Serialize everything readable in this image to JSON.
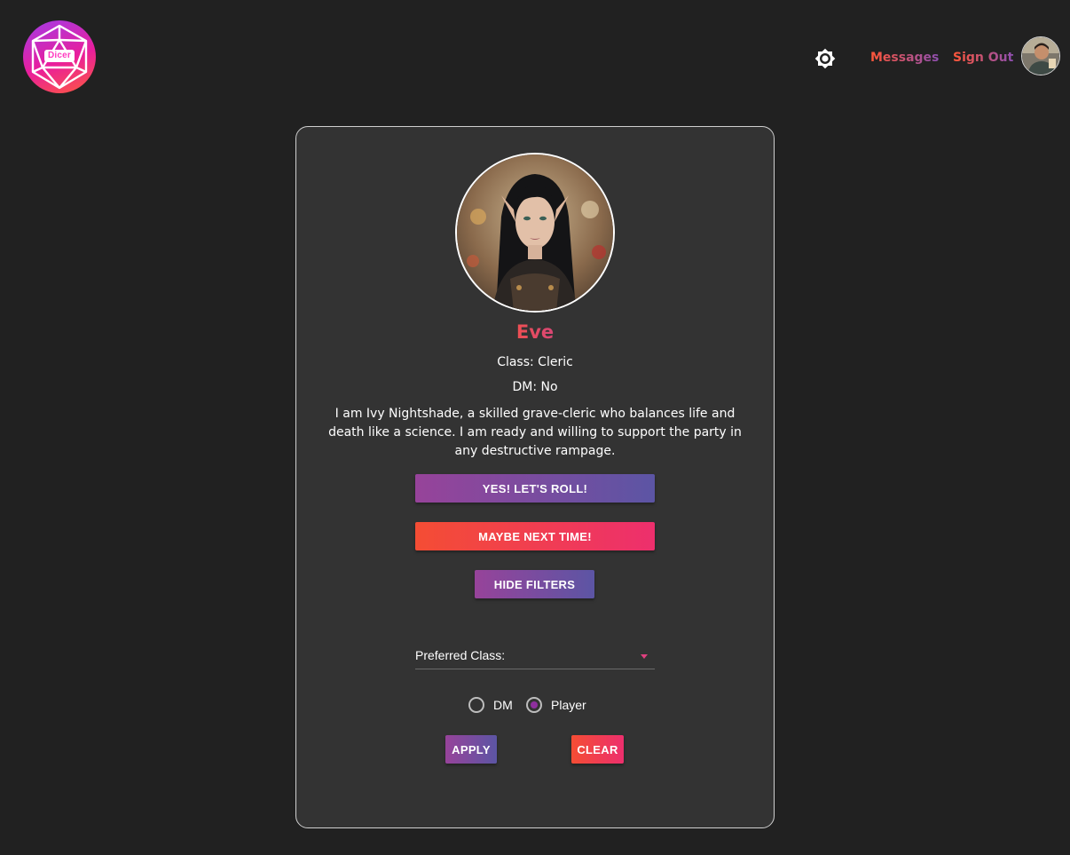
{
  "header": {
    "logo_text": "Dicer",
    "nav": {
      "messages_label": "Messages",
      "signout_label": "Sign Out"
    },
    "icons": {
      "theme": "brightness-icon",
      "user": "user-avatar"
    }
  },
  "profile": {
    "name": "Eve",
    "class_line": "Class: Cleric",
    "dm_line": "DM: No",
    "bio": "I am Ivy Nightshade, a skilled grave-cleric who balances life and death like a science. I am ready and willing to support the party in any destructive rampage."
  },
  "actions": {
    "yes_label": "YES! LET'S ROLL!",
    "maybe_label": "MAYBE NEXT TIME!",
    "hide_filters_label": "HIDE FILTERS"
  },
  "filters": {
    "preferred_class_label": "Preferred Class:",
    "radio_dm_label": "DM",
    "radio_player_label": "Player",
    "selected_role": "Player",
    "apply_label": "APPLY",
    "clear_label": "CLEAR"
  },
  "colors": {
    "background": "#212121",
    "card": "#333333",
    "accent_red": "#f44d34",
    "accent_pink": "#ed2f6d",
    "accent_purple": "#97439a",
    "accent_indigo": "#5c55a4"
  }
}
